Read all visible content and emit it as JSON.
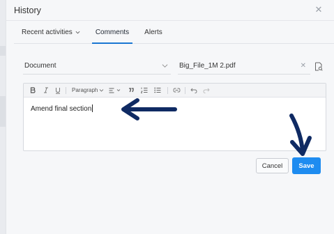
{
  "header": {
    "title": "History",
    "close_icon": "close-icon"
  },
  "tabs": [
    {
      "label": "Recent activities",
      "has_dropdown": true,
      "active": false
    },
    {
      "label": "Comments",
      "has_dropdown": false,
      "active": true
    },
    {
      "label": "Alerts",
      "has_dropdown": false,
      "active": false
    }
  ],
  "form": {
    "document_select": {
      "value": "Document"
    },
    "file_field": {
      "value": "Big_File_1M 2.pdf",
      "clear_icon": "close-icon"
    },
    "file_icon": "document-search-icon"
  },
  "editor": {
    "toolbar": {
      "paragraph_label": "Paragraph",
      "buttons": [
        "bold-icon",
        "italic-icon",
        "underline-icon",
        "align-icon",
        "quote-icon",
        "ordered-list-icon",
        "bullet-list-icon",
        "link-icon",
        "undo-icon",
        "redo-icon"
      ]
    },
    "content": "Amend final section"
  },
  "actions": {
    "cancel_label": "Cancel",
    "save_label": "Save"
  },
  "colors": {
    "accent": "#1976d2",
    "save_button": "#1e8cf0",
    "annotation_arrow": "#0f2a63"
  }
}
